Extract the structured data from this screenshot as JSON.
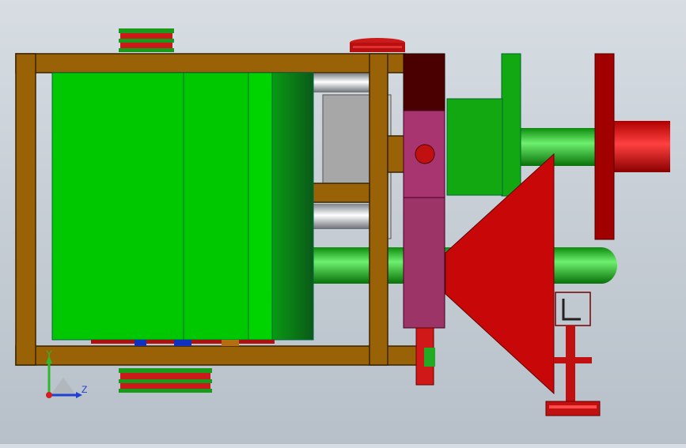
{
  "viewport": {
    "type": "3D CAD model view",
    "orientation_triad": {
      "vertical_axis_label": "Y",
      "horizontal_axis_label": "Z",
      "vertical_axis_color": "#2fb82f",
      "horizontal_axis_color": "#1f3fd1",
      "origin_color": "#d21f1f"
    }
  },
  "model": {
    "parts": [
      {
        "name": "frame",
        "color": "#9a6206"
      },
      {
        "name": "drum",
        "color": "#00c800"
      },
      {
        "name": "drum-end-shade",
        "color": "#0b7a1b"
      },
      {
        "name": "cone-hopper",
        "color": "#c80808"
      },
      {
        "name": "handwheel",
        "color": "#a00000"
      },
      {
        "name": "output-shaft",
        "color": "#e51010"
      },
      {
        "name": "green-shaft",
        "color": "#17b817"
      },
      {
        "name": "pink-housing",
        "color": "#9c3468"
      },
      {
        "name": "steel-rod",
        "color": "#b8bcc0"
      },
      {
        "name": "pulley",
        "color": "#cc1a1a"
      }
    ]
  }
}
